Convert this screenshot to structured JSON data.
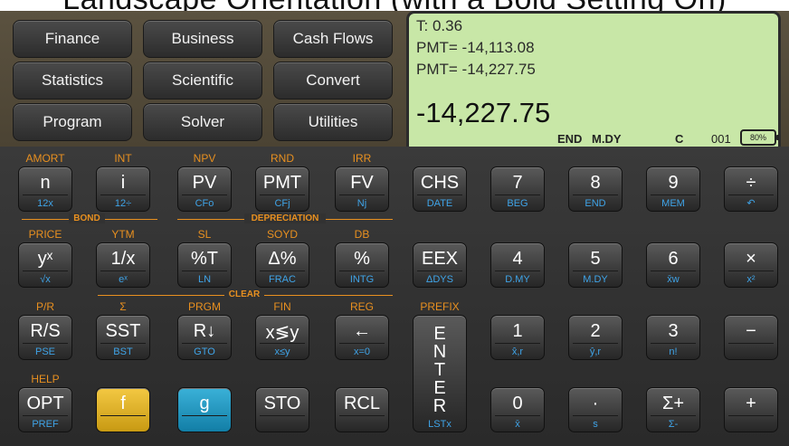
{
  "title": "Landscape Orientation (with a Bold Setting On)",
  "menu": {
    "finance": "Finance",
    "business": "Business",
    "cash_flows": "Cash Flows",
    "statistics": "Statistics",
    "scientific": "Scientific",
    "convert": "Convert",
    "program": "Program",
    "solver": "Solver",
    "utilities": "Utilities"
  },
  "display": {
    "line1": "T:  0.36",
    "line2": "PMT= -14,113.08",
    "line3": "PMT= -14,227.75",
    "main": "-14,227.75",
    "status_end": "END",
    "status_mode": "M.DY",
    "status_c": "C",
    "status_count": "001",
    "battery": "80%"
  },
  "keys_row1": [
    {
      "top": "AMORT",
      "main": "n",
      "sub": "12x"
    },
    {
      "top": "INT",
      "main": "i",
      "sub": "12÷"
    },
    {
      "top": "NPV",
      "main": "PV",
      "sub": "CFo"
    },
    {
      "top": "RND",
      "main": "PMT",
      "sub": "CFj"
    },
    {
      "top": "IRR",
      "main": "FV",
      "sub": "Nj"
    },
    {
      "top": "",
      "main": "CHS",
      "sub": "DATE"
    },
    {
      "top": "",
      "main": "7",
      "sub": "BEG"
    },
    {
      "top": "",
      "main": "8",
      "sub": "END"
    },
    {
      "top": "",
      "main": "9",
      "sub": "MEM"
    },
    {
      "top": "",
      "main": "÷",
      "sub": "↶"
    }
  ],
  "keys_row2": [
    {
      "top": "PRICE",
      "main": "yˣ",
      "sub": "√x"
    },
    {
      "top": "YTM",
      "main": "1/x",
      "sub": "eˣ"
    },
    {
      "top": "SL",
      "main": "%T",
      "sub": "LN"
    },
    {
      "top": "SOYD",
      "main": "Δ%",
      "sub": "FRAC"
    },
    {
      "top": "DB",
      "main": "%",
      "sub": "INTG"
    },
    {
      "top": "",
      "main": "EEX",
      "sub": "ΔDYS"
    },
    {
      "top": "",
      "main": "4",
      "sub": "D.MY"
    },
    {
      "top": "",
      "main": "5",
      "sub": "M.DY"
    },
    {
      "top": "",
      "main": "6",
      "sub": "x̄w"
    },
    {
      "top": "",
      "main": "×",
      "sub": "x²"
    }
  ],
  "keys_row3": [
    {
      "top": "P/R",
      "main": "R/S",
      "sub": "PSE"
    },
    {
      "top": "Σ",
      "main": "SST",
      "sub": "BST"
    },
    {
      "top": "PRGM",
      "main": "R↓",
      "sub": "GTO"
    },
    {
      "top": "FIN",
      "main": "x≶y",
      "sub": "x≤y"
    },
    {
      "top": "REG",
      "main": "←",
      "sub": "x=0"
    },
    {
      "top": "",
      "main": "1",
      "sub": "x̂,r"
    },
    {
      "top": "",
      "main": "2",
      "sub": "ŷ,r"
    },
    {
      "top": "",
      "main": "3",
      "sub": "n!"
    },
    {
      "top": "",
      "main": "−",
      "sub": ""
    }
  ],
  "keys_row4": [
    {
      "top": "HELP",
      "main": "OPT",
      "sub": "PREF"
    },
    {
      "top": "",
      "main": "f",
      "sub": ""
    },
    {
      "top": "",
      "main": "g",
      "sub": ""
    },
    {
      "top": "",
      "main": "STO",
      "sub": ""
    },
    {
      "top": "",
      "main": "RCL",
      "sub": ""
    },
    {
      "top": "",
      "main": "0",
      "sub": "x̄"
    },
    {
      "top": "",
      "main": "·",
      "sub": "s"
    },
    {
      "top": "",
      "main": "Σ+",
      "sub": "Σ-"
    },
    {
      "top": "",
      "main": "+",
      "sub": ""
    }
  ],
  "labels": {
    "bond": "BOND",
    "depreciation": "DEPRECIATION",
    "clear": "CLEAR",
    "prefix": "PREFIX"
  },
  "enter": {
    "main": "ENTER",
    "sub": "LSTx"
  }
}
